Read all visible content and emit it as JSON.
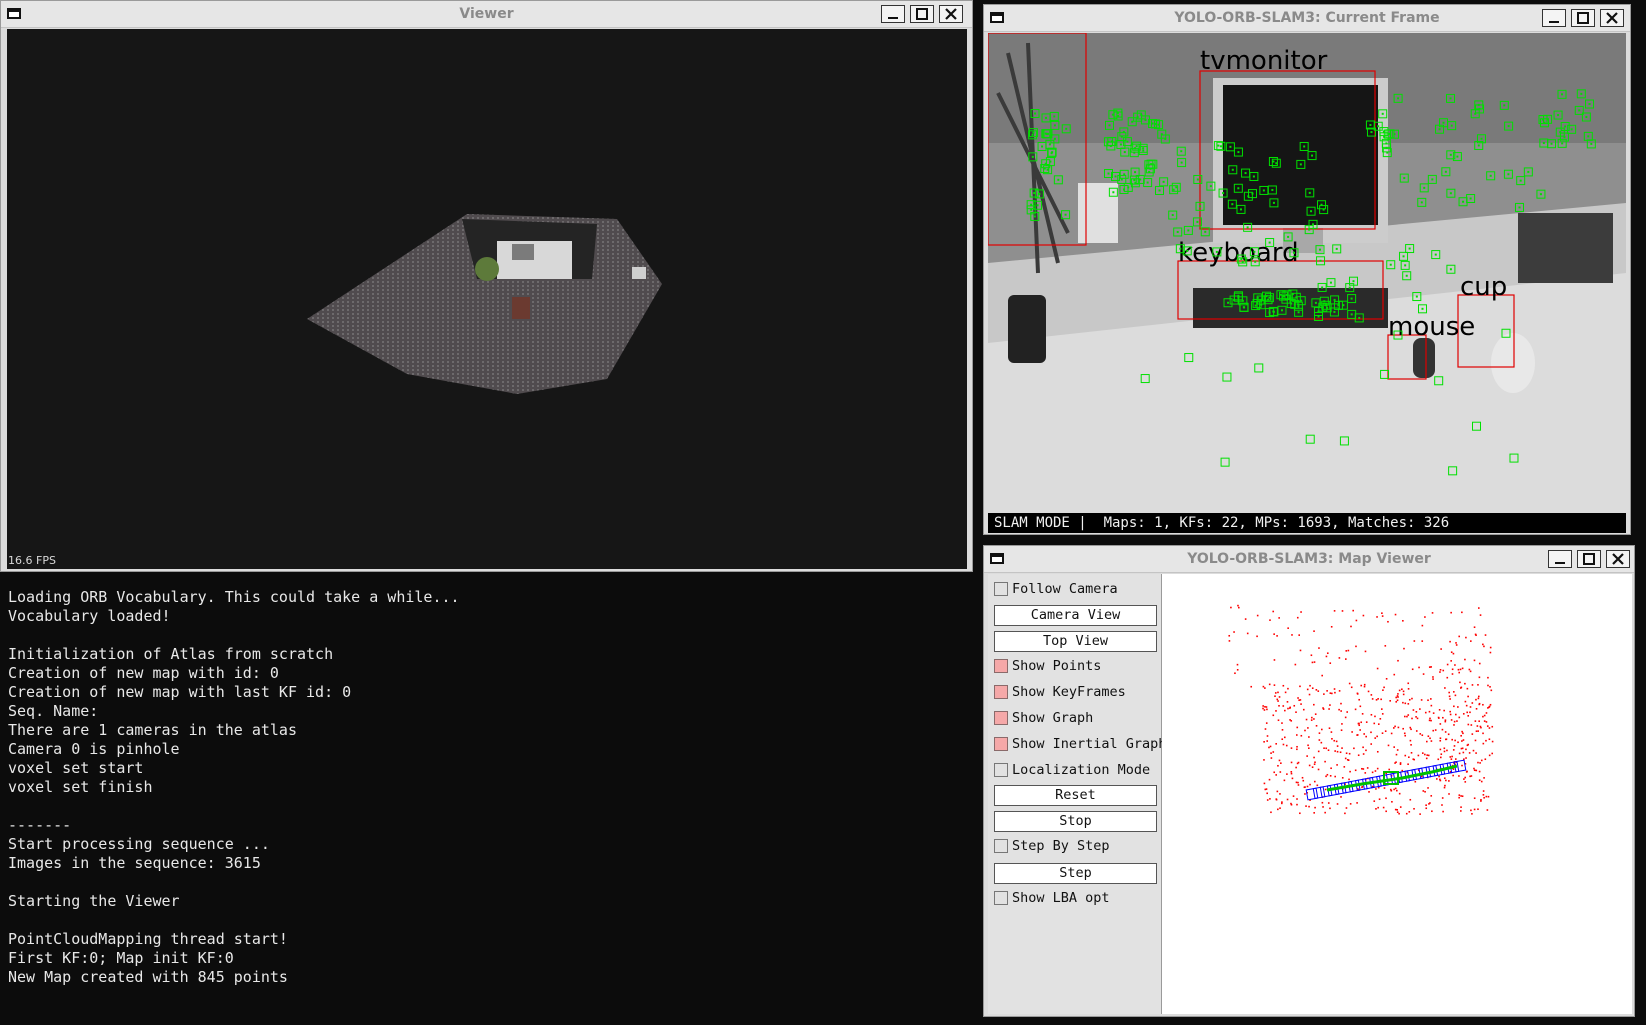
{
  "viewer": {
    "title": "Viewer",
    "fps": "16.6 FPS"
  },
  "console": {
    "lines": [
      "Loading ORB Vocabulary. This could take a while...",
      "Vocabulary loaded!",
      "",
      "Initialization of Atlas from scratch",
      "Creation of new map with id: 0",
      "Creation of new map with last KF id: 0",
      "Seq. Name:",
      "There are 1 cameras in the atlas",
      "Camera 0 is pinhole",
      "voxel set start",
      "voxel set finish",
      "",
      "-------",
      "Start processing sequence ...",
      "Images in the sequence: 3615",
      "",
      "Starting the Viewer",
      "",
      "PointCloudMapping thread start!",
      "First KF:0; Map init KF:0",
      "New Map created with 845 points"
    ]
  },
  "current_frame": {
    "title": "YOLO-ORB-SLAM3: Current Frame",
    "status": "SLAM MODE |  Maps: 1, KFs: 22, MPs: 1693, Matches: 326",
    "detections": [
      {
        "label": "tvmonitor"
      },
      {
        "label": "keyboard"
      },
      {
        "label": "cup"
      },
      {
        "label": "mouse"
      }
    ],
    "colors": {
      "feature": "#00e000",
      "bbox": "#e00000",
      "label": "#000000"
    }
  },
  "map_viewer": {
    "title": "YOLO-ORB-SLAM3: Map Viewer",
    "checkboxes": [
      {
        "label": "Follow Camera",
        "checked": false
      },
      {
        "label": "Show Points",
        "checked": true
      },
      {
        "label": "Show KeyFrames",
        "checked": true
      },
      {
        "label": "Show Graph",
        "checked": true
      },
      {
        "label": "Show Inertial Graph",
        "checked": true
      },
      {
        "label": "Localization Mode",
        "checked": false
      },
      {
        "label": "Step By Step",
        "checked": false
      },
      {
        "label": "Show LBA opt",
        "checked": false
      }
    ],
    "buttons": {
      "camera_view": "Camera View",
      "top_view": "Top View",
      "reset": "Reset",
      "stop": "Stop",
      "step": "Step"
    },
    "colors": {
      "map_points": "#ff0000",
      "keyframes": "#0000ff",
      "graph": "#00c000"
    }
  }
}
